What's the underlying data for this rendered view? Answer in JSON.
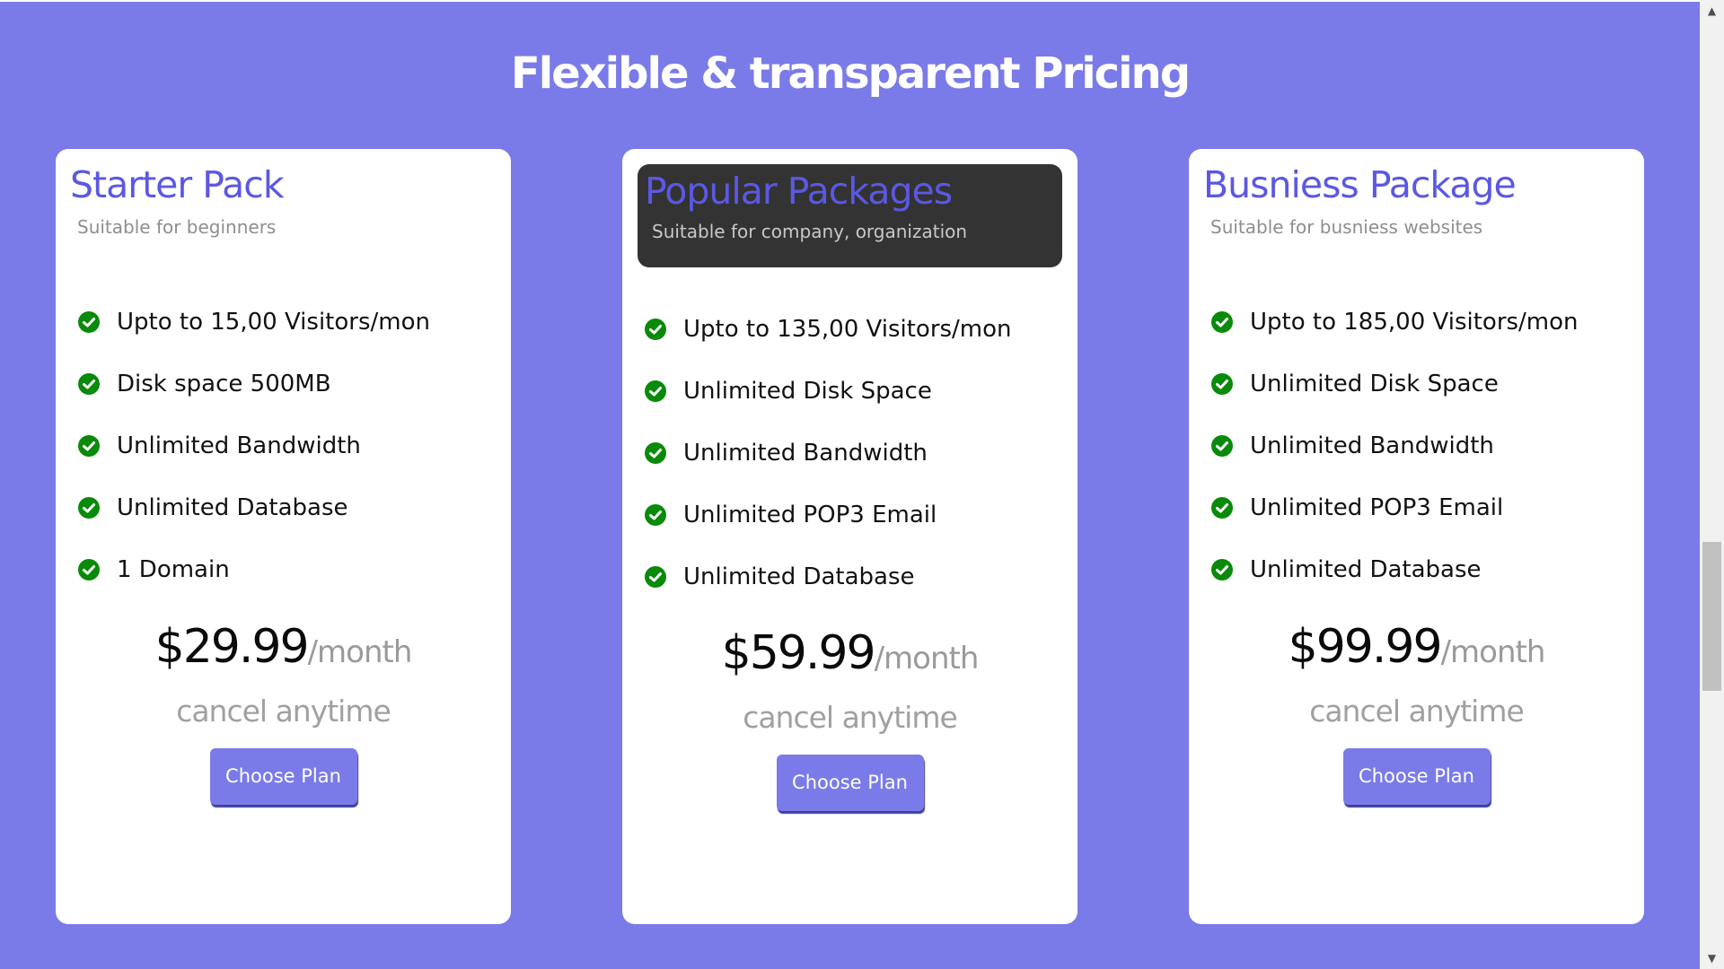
{
  "page": {
    "heading": "Flexible & transparent Pricing",
    "background_color": "#7a7be8",
    "accent_color": "#5b58e3",
    "check_color": "#0a8a0a"
  },
  "plans": [
    {
      "title": "Starter Pack",
      "subtitle": "Suitable for beginners",
      "featured": false,
      "features": [
        "Upto to 15,00 Visitors/mon",
        "Disk space 500MB",
        "Unlimited Bandwidth",
        "Unlimited Database",
        "1 Domain"
      ],
      "price": "$29.99",
      "period": "/month",
      "note": "cancel anytime",
      "button_label": "Choose Plan"
    },
    {
      "title": "Popular Packages",
      "subtitle": "Suitable for company, organization",
      "featured": true,
      "features": [
        "Upto to 135,00 Visitors/mon",
        "Unlimited Disk Space",
        "Unlimited Bandwidth",
        "Unlimited POP3 Email",
        "Unlimited Database"
      ],
      "price": "$59.99",
      "period": "/month",
      "note": "cancel anytime",
      "button_label": "Choose Plan"
    },
    {
      "title": "Busniess Package",
      "subtitle": "Suitable for busniess websites",
      "featured": false,
      "features": [
        "Upto to 185,00 Visitors/mon",
        "Unlimited Disk Space",
        "Unlimited Bandwidth",
        "Unlimited POP3 Email",
        "Unlimited Database"
      ],
      "price": "$99.99",
      "period": "/month",
      "note": "cancel anytime",
      "button_label": "Choose Plan"
    }
  ],
  "icons": {
    "feature_bullet": "check-circle-icon",
    "scroll_up": "chevron-up-icon",
    "scroll_down": "chevron-down-icon"
  }
}
